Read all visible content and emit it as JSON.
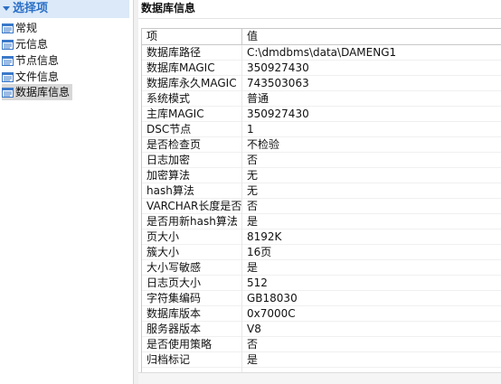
{
  "nav": {
    "header": "选择项",
    "items": [
      {
        "label": "常规"
      },
      {
        "label": "元信息"
      },
      {
        "label": "节点信息"
      },
      {
        "label": "文件信息"
      },
      {
        "label": "数据库信息"
      }
    ],
    "selected_index": 4
  },
  "panel": {
    "title": "数据库信息",
    "columns": [
      "项",
      "值"
    ],
    "rows": [
      [
        "数据库路径",
        "C:\\dmdbms\\data\\DAMENG1"
      ],
      [
        "数据库MAGIC",
        "350927430"
      ],
      [
        "数据库永久MAGIC",
        "743503063"
      ],
      [
        "系统模式",
        "普通"
      ],
      [
        "主库MAGIC",
        "350927430"
      ],
      [
        "DSC节点",
        "1"
      ],
      [
        "是否检查页",
        "不检验"
      ],
      [
        "日志加密",
        "否"
      ],
      [
        "加密算法",
        "无"
      ],
      [
        "hash算法",
        "无"
      ],
      [
        "VARCHAR长度是否以",
        "否"
      ],
      [
        "是否用新hash算法",
        "是"
      ],
      [
        "页大小",
        "8192K"
      ],
      [
        "簇大小",
        "16页"
      ],
      [
        "大小写敏感",
        "是"
      ],
      [
        "日志页大小",
        "512"
      ],
      [
        "字符集编码",
        "GB18030"
      ],
      [
        "数据库版本",
        "0x7000C"
      ],
      [
        "服务器版本",
        "V8"
      ],
      [
        "是否使用策略",
        "否"
      ],
      [
        "归档标记",
        "是"
      ],
      [
        "",
        ""
      ]
    ]
  },
  "colors": {
    "nav_header_bg": "#dbe9f8",
    "nav_header_text": "#2b6fc6",
    "selected_bg": "#d8d8d8",
    "icon_blue": "#3a78c8"
  },
  "icons": {
    "nav_header": "triangle-down-icon",
    "nav_item": "list-window-icon"
  }
}
